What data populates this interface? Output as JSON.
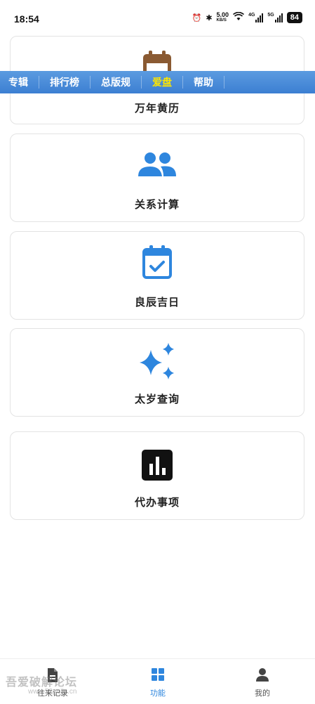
{
  "status": {
    "time": "18:54",
    "speed": "5.00",
    "speed_unit": "KB/S",
    "net1": "4G",
    "net2": "5G",
    "battery": "84"
  },
  "topnav": {
    "items": [
      {
        "label": "专辑"
      },
      {
        "label": "排行榜"
      },
      {
        "label": "总版规"
      },
      {
        "label": "爱盘"
      },
      {
        "label": "帮助"
      }
    ]
  },
  "cards": [
    {
      "label": "万年黄历",
      "icon": "calendar-icon"
    },
    {
      "label": "关系计算",
      "icon": "people-icon"
    },
    {
      "label": "良辰吉日",
      "icon": "calendar-check-icon"
    },
    {
      "label": "太岁查询",
      "icon": "sparkle-icon"
    },
    {
      "label": "代办事项",
      "icon": "bar-chart-icon"
    }
  ],
  "tabs": [
    {
      "label": "往来记录",
      "icon": "document-icon"
    },
    {
      "label": "功能",
      "icon": "grid-icon"
    },
    {
      "label": "我的",
      "icon": "person-icon"
    }
  ],
  "watermark": {
    "text": "吾爱破解论坛",
    "sub": "www.52pojie.cn"
  },
  "colors": {
    "accent": "#2e86de",
    "nav_bg": "#3c7fd2",
    "nav_active": "#ffe600"
  }
}
